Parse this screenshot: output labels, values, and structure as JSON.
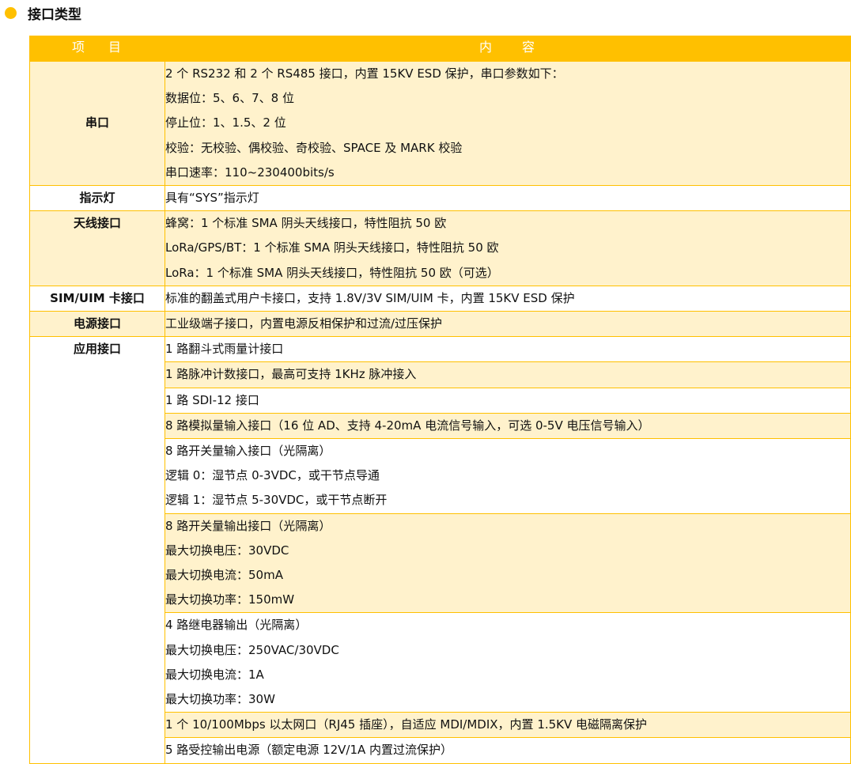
{
  "section": {
    "title": "接口类型"
  },
  "header": {
    "col1": [
      "项",
      "目"
    ],
    "col2": [
      "内",
      "容"
    ]
  },
  "rows": [
    {
      "item": "串口",
      "lines": [
        "2 个 RS232 和 2 个 RS485 接口，内置 15KV ESD 保护，串口参数如下：",
        "数据位：5、6、7、8 位",
        "停止位：1、1.5、2 位",
        "校验：无校验、偶校验、奇校验、SPACE 及 MARK 校验",
        "串口速率：110~230400bits/s"
      ]
    },
    {
      "item": "指示灯",
      "lines": [
        "具有“SYS”指示灯"
      ]
    },
    {
      "item": "天线接口",
      "lines": [
        "蜂窝：1 个标准 SMA 阴头天线接口，特性阻抗 50 欧",
        "LoRa/GPS/BT：1 个标准 SMA 阴头天线接口，特性阻抗 50 欧",
        "LoRa：1 个标准 SMA 阴头天线接口，特性阻抗 50 欧（可选）"
      ]
    },
    {
      "item": "SIM/UIM 卡接口",
      "lines": [
        "标准的翻盖式用户卡接口，支持 1.8V/3V SIM/UIM 卡，内置 15KV ESD 保护"
      ]
    },
    {
      "item": "电源接口",
      "lines": [
        "工业级端子接口，内置电源反相保护和过流/过压保护"
      ]
    }
  ],
  "app": {
    "item": "应用接口",
    "groups": [
      [
        "1 路翻斗式雨量计接口"
      ],
      [
        "1 路脉冲计数接口，最高可支持 1KHz 脉冲接入"
      ],
      [
        "1 路 SDI-12 接口"
      ],
      [
        "8 路模拟量输入接口（16 位 AD、支持 4-20mA 电流信号输入，可选 0-5V 电压信号输入）"
      ],
      [
        "8 路开关量输入接口（光隔离）",
        "逻辑 0：湿节点 0-3VDC，或干节点导通",
        "逻辑 1：湿节点 5-30VDC，或干节点断开"
      ],
      [
        "8 路开关量输出接口（光隔离）",
        "最大切换电压：30VDC",
        "最大切换电流：50mA",
        "最大切换功率：150mW"
      ],
      [
        "4 路继电器输出（光隔离）",
        "最大切换电压：250VAC/30VDC",
        "最大切换电流：1A",
        "最大切换功率：30W"
      ],
      [
        "1 个 10/100Mbps 以太网口（RJ45 插座），自适应 MDI/MDIX，内置 1.5KV 电磁隔离保护"
      ],
      [
        "5 路受控输出电源（额定电源 12V/1A 内置过流保护）"
      ]
    ]
  },
  "colors": {
    "accent": "#FFC000",
    "shade": "#FFF2CC"
  }
}
